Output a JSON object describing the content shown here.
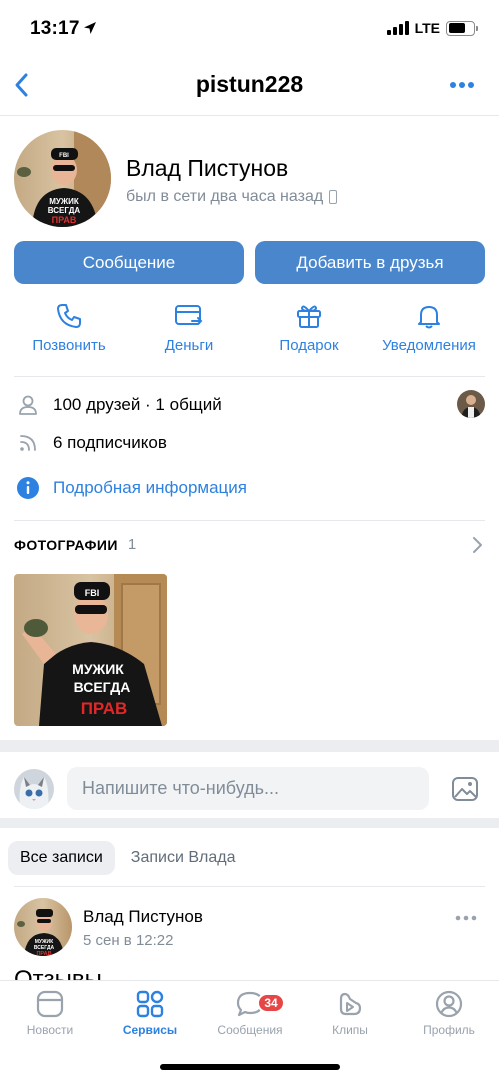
{
  "status": {
    "time": "13:17",
    "network": "LTE",
    "battery_level": 0.7
  },
  "nav": {
    "title": "pistun228",
    "back_icon": "chevron-left-icon",
    "more_icon": "more-horizontal-icon"
  },
  "profile": {
    "name": "Влад Пистунов",
    "last_seen": "был в сети два часа назад",
    "message_button": "Сообщение",
    "add_friend_button": "Добавить в друзья"
  },
  "actions": [
    {
      "label": "Позвонить",
      "icon": "phone-icon"
    },
    {
      "label": "Деньги",
      "icon": "money-icon"
    },
    {
      "label": "Подарок",
      "icon": "gift-icon"
    },
    {
      "label": "Уведомления",
      "icon": "bell-icon"
    }
  ],
  "info": {
    "friends": "100 друзей · 1 общий",
    "followers": "6 подписчиков",
    "details_link": "Подробная информация"
  },
  "photos": {
    "title": "ФОТОГРАФИИ",
    "count": "1",
    "shirt_text": [
      "МУЖИК",
      "ВСЕГДА",
      "ПРАВ"
    ],
    "cap_text": "FBI"
  },
  "composer": {
    "placeholder": "Напишите что-нибудь..."
  },
  "wall_tabs": {
    "all": "Все записи",
    "own": "Записи Влада"
  },
  "post": {
    "author": "Влад Пистунов",
    "date": "5 сен в 12:22",
    "text": "Отзывы"
  },
  "tabbar": {
    "items": [
      {
        "label": "Новости",
        "icon": "news-icon"
      },
      {
        "label": "Сервисы",
        "icon": "services-icon"
      },
      {
        "label": "Сообщения",
        "icon": "messages-icon",
        "badge": "34"
      },
      {
        "label": "Клипы",
        "icon": "clips-icon"
      },
      {
        "label": "Профиль",
        "icon": "profile-icon"
      }
    ]
  },
  "colors": {
    "accent": "#2d81e0",
    "button": "#4986cc",
    "secondary_text": "#818c99",
    "badge": "#e64646",
    "separator": "#ebedf0"
  }
}
